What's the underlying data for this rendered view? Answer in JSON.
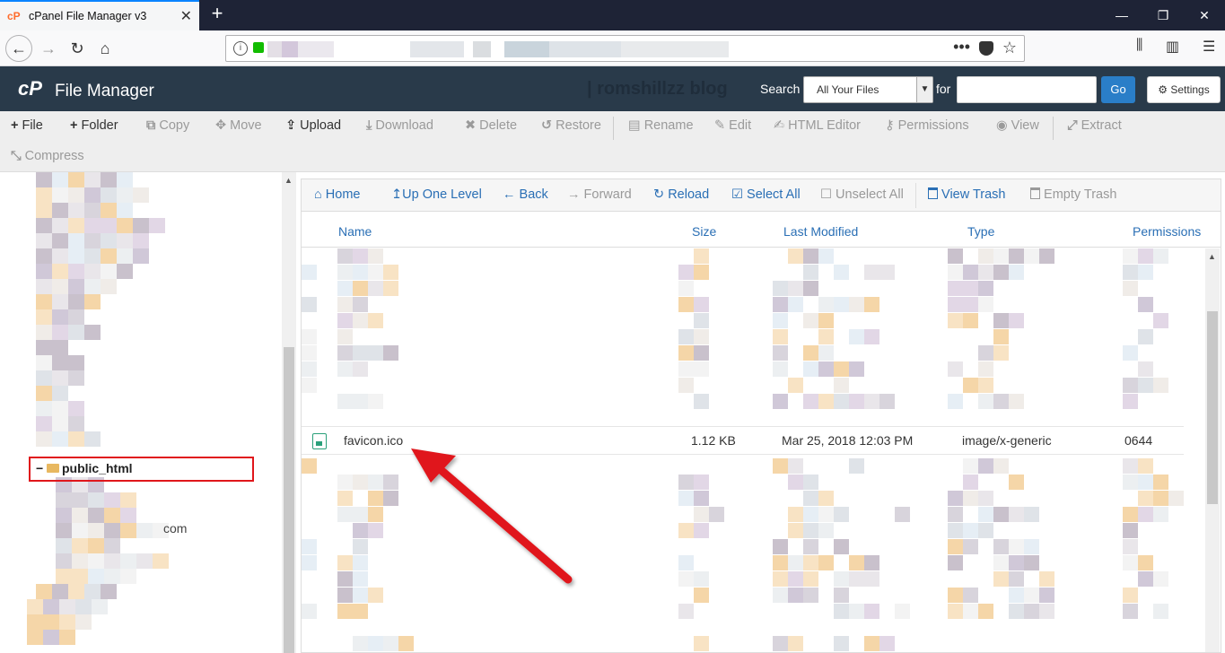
{
  "browser": {
    "tab_title": "cPanel File Manager v3",
    "favicon_text": "cP",
    "tab_close": "✕",
    "new_tab": "+",
    "window_controls": [
      "—",
      "❐",
      "✕"
    ],
    "nav_icons": [
      "back-icon",
      "forward-icon",
      "reload-icon",
      "home-icon"
    ],
    "url_actions": [
      "page-actions-icon",
      "pocket-icon",
      "bookmark-star-icon"
    ],
    "right_icons": [
      "library-icon",
      "sidebar-icon",
      "menu-icon"
    ]
  },
  "header": {
    "logo": "cP",
    "title": "File Manager",
    "watermark": "| romshillzz blog",
    "search_label": "Search",
    "search_scope": "All Your Files",
    "for_label": "for",
    "search_value": "",
    "go_label": "Go",
    "settings_label": "Settings"
  },
  "toolbar": {
    "row1": [
      {
        "icon": "plus-icon",
        "glyph": "+",
        "label": "File",
        "enabled": true
      },
      {
        "icon": "plus-icon",
        "glyph": "+",
        "label": "Folder",
        "enabled": true
      },
      {
        "icon": "copy-icon",
        "glyph": "⧉",
        "label": "Copy",
        "enabled": false
      },
      {
        "icon": "move-icon",
        "glyph": "✥",
        "label": "Move",
        "enabled": false
      },
      {
        "icon": "upload-icon",
        "glyph": "⇪",
        "label": "Upload",
        "enabled": true
      },
      {
        "icon": "download-icon",
        "glyph": "⤓",
        "label": "Download",
        "enabled": false
      },
      {
        "icon": "delete-icon",
        "glyph": "✖",
        "label": "Delete",
        "enabled": false
      },
      {
        "icon": "restore-icon",
        "glyph": "↺",
        "label": "Restore",
        "enabled": false
      },
      {
        "icon": "rename-icon",
        "glyph": "▤",
        "label": "Rename",
        "enabled": false
      },
      {
        "icon": "edit-icon",
        "glyph": "✎",
        "label": "Edit",
        "enabled": false
      },
      {
        "icon": "html-editor-icon",
        "glyph": "✍",
        "label": "HTML Editor",
        "enabled": false
      },
      {
        "icon": "permissions-icon",
        "glyph": "⚷",
        "label": "Permissions",
        "enabled": false
      },
      {
        "icon": "view-icon",
        "glyph": "◉",
        "label": "View",
        "enabled": false
      },
      {
        "icon": "extract-icon",
        "glyph": "⤢",
        "label": "Extract",
        "enabled": false
      }
    ],
    "row2": [
      {
        "icon": "compress-icon",
        "glyph": "⤡",
        "label": "Compress",
        "enabled": false
      }
    ]
  },
  "tree": {
    "selected_folder": "public_html",
    "partial_text": "com"
  },
  "file_nav": [
    {
      "icon": "home-icon",
      "glyph": "⌂",
      "label": "Home",
      "enabled": true
    },
    {
      "icon": "up-level-icon",
      "glyph": "↥",
      "label": "Up One Level",
      "enabled": true
    },
    {
      "icon": "back-arrow-icon",
      "glyph": "←",
      "label": "Back",
      "enabled": true
    },
    {
      "icon": "forward-arrow-icon",
      "glyph": "→",
      "label": "Forward",
      "enabled": false
    },
    {
      "icon": "reload-icon",
      "glyph": "↻",
      "label": "Reload",
      "enabled": true
    },
    {
      "icon": "select-all-icon",
      "glyph": "☑",
      "label": "Select All",
      "enabled": true
    },
    {
      "icon": "unselect-all-icon",
      "glyph": "☐",
      "label": "Unselect All",
      "enabled": false
    },
    {
      "icon": "trash-icon",
      "glyph": "🗑",
      "label": "View Trash",
      "enabled": true
    },
    {
      "icon": "trash-icon",
      "glyph": "🗑",
      "label": "Empty Trash",
      "enabled": false
    }
  ],
  "columns": {
    "name": "Name",
    "size": "Size",
    "modified": "Last Modified",
    "type": "Type",
    "permissions": "Permissions"
  },
  "highlighted_file": {
    "name": "favicon.ico",
    "size": "1.12 KB",
    "modified": "Mar 25, 2018 12:03 PM",
    "type": "image/x-generic",
    "permissions": "0644"
  },
  "colors": {
    "header_bg": "#293a4a",
    "link_blue": "#2a6fb5",
    "highlight_red": "#e0161b",
    "go_blue": "#2a7ec8"
  }
}
